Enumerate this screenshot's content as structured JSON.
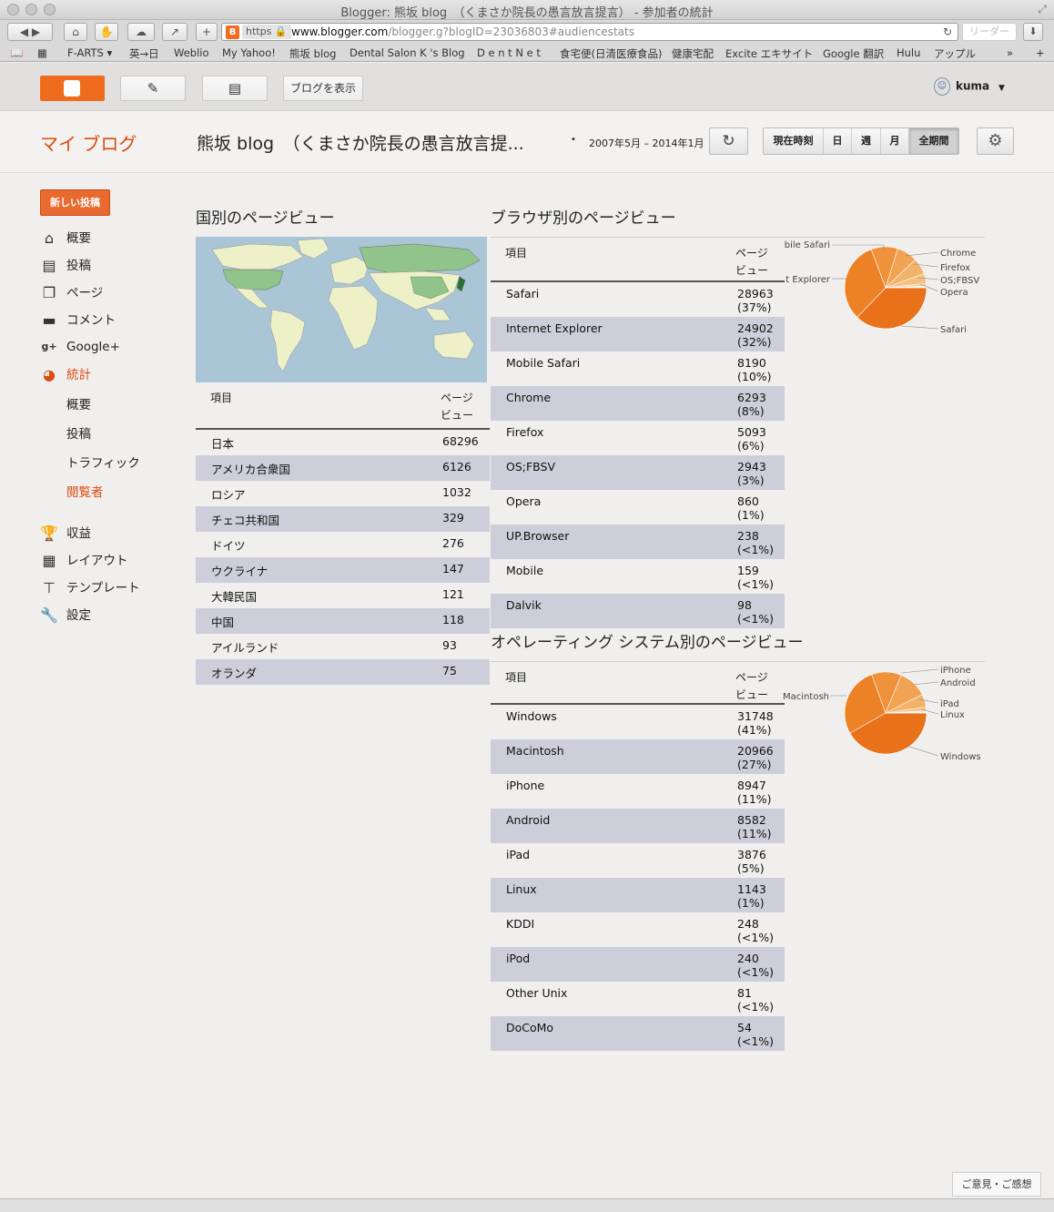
{
  "window": {
    "title": "Blogger: 熊坂 blog　（くまさか院長の愚言放言提言） - 参加者の統計"
  },
  "browser": {
    "https_label": "https",
    "url_host": "www.blogger.com",
    "url_path": "/blogger.g?blogID=23036803#audiencestats",
    "reader_label": "リーダー",
    "bookmarks": [
      "F-ARTS ▾",
      "英→日",
      "Weblio",
      "My Yahoo!",
      "熊坂 blog",
      "Dental Salon K 's Blog",
      "D e n t N e t",
      "食宅便(日清医療食品)",
      "健康宅配",
      "Excite エキサイト",
      "Google 翻訳",
      "Hulu",
      "アップル"
    ]
  },
  "blogger_bar": {
    "view_blog_label": "ブログを表示",
    "user_name": "kuma"
  },
  "header": {
    "my_blog": "マイ ブログ",
    "blog_title": "熊坂 blog　（くまさか院長の愚言放言提...",
    "date_range": "2007年5月 – 2014年1月",
    "range_buttons": [
      "現在時刻",
      "日",
      "週",
      "月",
      "全期間"
    ]
  },
  "sidebar": {
    "new_post": "新しい投稿",
    "items": [
      "概要",
      "投稿",
      "ページ",
      "コメント",
      "Google+",
      "統計"
    ],
    "stats_sub": [
      "概要",
      "投稿",
      "トラフィック",
      "閲覧者"
    ],
    "items2": [
      "収益",
      "レイアウト",
      "テンプレート",
      "設定"
    ]
  },
  "country": {
    "title": "国別のページビュー",
    "col_item": "項目",
    "col_views_1": "ページ",
    "col_views_2": "ビュー",
    "rows": [
      {
        "name": "日本",
        "views": "68296"
      },
      {
        "name": "アメリカ合衆国",
        "views": "6126"
      },
      {
        "name": "ロシア",
        "views": "1032"
      },
      {
        "name": "チェコ共和国",
        "views": "329"
      },
      {
        "name": "ドイツ",
        "views": "276"
      },
      {
        "name": "ウクライナ",
        "views": "147"
      },
      {
        "name": "大韓民国",
        "views": "121"
      },
      {
        "name": "中国",
        "views": "118"
      },
      {
        "name": "アイルランド",
        "views": "93"
      },
      {
        "name": "オランダ",
        "views": "75"
      }
    ]
  },
  "browser_stats": {
    "title": "ブラウザ別のページビュー",
    "col_item": "項目",
    "col_views_1": "ページ",
    "col_views_2": "ビュー",
    "rows": [
      {
        "name": "Safari",
        "views": "28963",
        "pct": "(37%)"
      },
      {
        "name": "Internet Explorer",
        "views": "24902",
        "pct": "(32%)"
      },
      {
        "name": "Mobile Safari",
        "views": "8190",
        "pct": "(10%)"
      },
      {
        "name": "Chrome",
        "views": "6293",
        "pct": "(8%)"
      },
      {
        "name": "Firefox",
        "views": "5093",
        "pct": "(6%)"
      },
      {
        "name": "OS;FBSV",
        "views": "2943",
        "pct": "(3%)"
      },
      {
        "name": "Opera",
        "views": "860",
        "pct": "(1%)"
      },
      {
        "name": "UP.Browser",
        "views": "238",
        "pct": "(<1%)"
      },
      {
        "name": "Mobile",
        "views": "159",
        "pct": "(<1%)"
      },
      {
        "name": "Dalvik",
        "views": "98",
        "pct": "(<1%)"
      }
    ],
    "pie_labels": [
      "bile Safari",
      "t Explorer",
      "Chrome",
      "Firefox",
      "OS;FBSV",
      "Opera",
      "Safari"
    ]
  },
  "os_stats": {
    "title": "オペレーティング システム別のページビュー",
    "col_item": "項目",
    "col_views_1": "ページ",
    "col_views_2": "ビュー",
    "rows": [
      {
        "name": "Windows",
        "views": "31748",
        "pct": "(41%)"
      },
      {
        "name": "Macintosh",
        "views": "20966",
        "pct": "(27%)"
      },
      {
        "name": "iPhone",
        "views": "8947",
        "pct": "(11%)"
      },
      {
        "name": "Android",
        "views": "8582",
        "pct": "(11%)"
      },
      {
        "name": "iPad",
        "views": "3876",
        "pct": "(5%)"
      },
      {
        "name": "Linux",
        "views": "1143",
        "pct": "(1%)"
      },
      {
        "name": "KDDI",
        "views": "248",
        "pct": "(<1%)"
      },
      {
        "name": "iPod",
        "views": "240",
        "pct": "(<1%)"
      },
      {
        "name": "Other Unix",
        "views": "81",
        "pct": "(<1%)"
      },
      {
        "name": "DoCoMo",
        "views": "54",
        "pct": "(<1%)"
      }
    ],
    "pie_labels": [
      "iPhone",
      "Android",
      "Macintosh",
      "iPad",
      "Linux",
      "Windows"
    ]
  },
  "feedback_label": "ご意見・ご感想",
  "colors": {
    "accent": "#dd4b10",
    "blogger_orange": "#ef6c1f",
    "pie_main": "#e8711a",
    "row_alt": "#cdced9"
  }
}
